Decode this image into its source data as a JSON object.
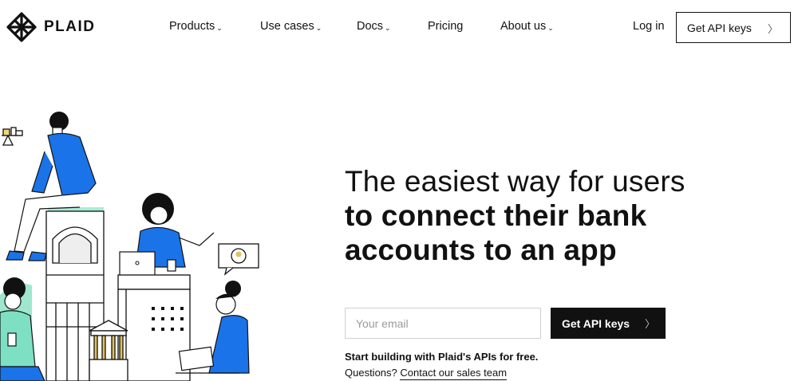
{
  "brand": {
    "name": "PLAID",
    "logo_icon": "plaid-tartan-icon"
  },
  "nav": {
    "items": [
      {
        "label": "Products",
        "has_dropdown": true
      },
      {
        "label": "Use cases",
        "has_dropdown": true
      },
      {
        "label": "Docs",
        "has_dropdown": true
      },
      {
        "label": "Pricing",
        "has_dropdown": false
      },
      {
        "label": "About us",
        "has_dropdown": true
      }
    ],
    "dropdown_glyph": "⌄",
    "login_label": "Log in",
    "cta_label": "Get API keys",
    "cta_arrow": "〉"
  },
  "hero": {
    "title_line1": "The easiest way for users",
    "title_line2": "to connect their bank",
    "title_line3": "accounts to an app",
    "email_placeholder": "Your email",
    "email_value": "",
    "cta_label": "Get API keys",
    "cta_arrow": "〉",
    "subtext": "Start building with Plaid's APIs for free.",
    "questions_prefix": "Questions?",
    "contact_link": "Contact our sales team"
  },
  "colors": {
    "accent_blue": "#1a73e8",
    "mint": "#7ee0c3",
    "gold": "#e2c25a",
    "ink": "#111111",
    "border": "#cfcfcf"
  }
}
